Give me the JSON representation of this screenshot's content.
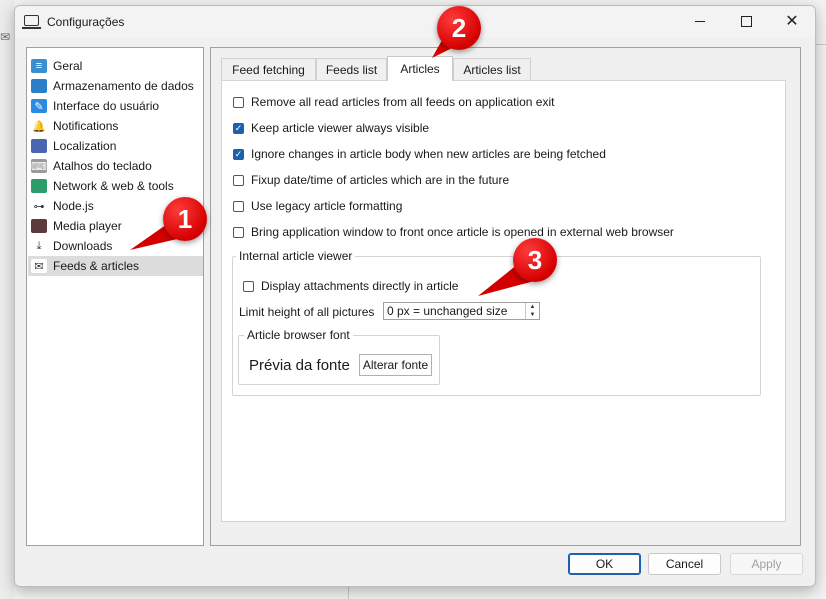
{
  "window": {
    "title": "Configurações",
    "controls": {
      "minimize": "minimize-icon",
      "maximize": "maximize-icon",
      "close": "✕"
    }
  },
  "sidebar": {
    "items": [
      {
        "label": "Geral",
        "icon": "general-icon",
        "color": "#3a8fd0",
        "glyph": "≡"
      },
      {
        "label": "Armazenamento de dados",
        "icon": "folder-icon",
        "color": "#2c7fc6",
        "glyph": ""
      },
      {
        "label": "Interface do usuário",
        "icon": "ui-icon",
        "color": "#2b8be0",
        "glyph": "✎"
      },
      {
        "label": "Notifications",
        "icon": "bell-icon",
        "color": "#ffffff",
        "glyph": "🔔"
      },
      {
        "label": "Localization",
        "icon": "localization-icon",
        "color": "#4b66b0",
        "glyph": ""
      },
      {
        "label": "Atalhos do teclado",
        "icon": "keyboard-icon",
        "color": "#9a9a9a",
        "glyph": "⌨"
      },
      {
        "label": "Network & web & tools",
        "icon": "globe-icon",
        "color": "#2a9d6a",
        "glyph": ""
      },
      {
        "label": "Node.js",
        "icon": "nodejs-icon",
        "color": "#ffffff",
        "glyph": "⊶"
      },
      {
        "label": "Media player",
        "icon": "film-icon",
        "color": "#5a3a3a",
        "glyph": ""
      },
      {
        "label": "Downloads",
        "icon": "download-icon",
        "color": "#ffffff",
        "glyph": "⤓"
      },
      {
        "label": "Feeds & articles",
        "icon": "envelope-icon",
        "color": "#ffffff",
        "glyph": "✉"
      }
    ],
    "selected": "Feeds & articles"
  },
  "tabs": [
    {
      "label": "Feed fetching",
      "active": false
    },
    {
      "label": "Feeds list",
      "active": false
    },
    {
      "label": "Articles",
      "active": true
    },
    {
      "label": "Articles list",
      "active": false
    }
  ],
  "articles": {
    "options": [
      {
        "label": "Remove all read articles from all feeds on application exit",
        "checked": false
      },
      {
        "label": "Keep article viewer always visible",
        "checked": true
      },
      {
        "label": "Ignore changes in article body when new articles are being fetched",
        "checked": true
      },
      {
        "label": "Fixup date/time of articles which are in the future",
        "checked": false
      },
      {
        "label": "Use legacy article formatting",
        "checked": false
      },
      {
        "label": "Bring application window to front once article is opened in external web browser",
        "checked": false
      }
    ],
    "internal_viewer": {
      "title": "Internal article viewer",
      "display_attachments": {
        "label": "Display attachments directly in article",
        "checked": false
      },
      "limit_height_label": "Limit height of all pictures",
      "limit_height_value": "0 px = unchanged size",
      "font_group": {
        "title": "Article browser font",
        "preview": "Prévia da fonte",
        "change_button": "Alterar fonte"
      }
    }
  },
  "footer": {
    "ok": "OK",
    "cancel": "Cancel",
    "apply": "Apply"
  },
  "annotations": [
    "1",
    "2",
    "3"
  ],
  "colors": {
    "accent": "#1f5fb0",
    "callout": "#d40000",
    "selection": "#dcdcdc"
  }
}
